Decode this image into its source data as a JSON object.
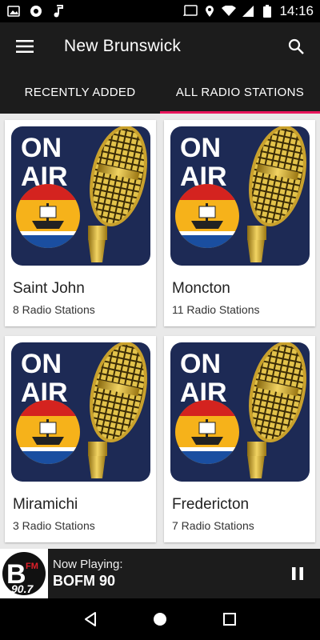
{
  "status_bar": {
    "time": "14:16",
    "icons": [
      "photo-icon",
      "aperture-icon",
      "music-note-icon",
      "cast-icon",
      "location-icon",
      "wifi-icon",
      "signal-icon",
      "battery-icon"
    ]
  },
  "app_bar": {
    "title": "New Brunswick",
    "menu_icon": "hamburger-menu-icon",
    "search_icon": "search-icon"
  },
  "tabs": [
    {
      "label": "RECENTLY ADDED",
      "active": false
    },
    {
      "label": "ALL RADIO STATIONS",
      "active": true
    }
  ],
  "cities": [
    {
      "name": "Saint John",
      "count": "8 Radio Stations"
    },
    {
      "name": "Moncton",
      "count": "11 Radio Stations"
    },
    {
      "name": "Miramichi",
      "count": "3 Radio Stations"
    },
    {
      "name": "Fredericton",
      "count": "7 Radio Stations"
    }
  ],
  "thumbnail": {
    "line1": "ON",
    "line2": "AIR"
  },
  "now_playing": {
    "label": "Now Playing:",
    "station": "BOFM 90",
    "logo_text": "B",
    "logo_sub": "FM",
    "logo_freq": "90.7"
  },
  "colors": {
    "accent": "#e8175d",
    "bar": "#1c1c1c",
    "grid_bg": "#e9e9e9",
    "thumb_bg": "#1d2a55"
  }
}
